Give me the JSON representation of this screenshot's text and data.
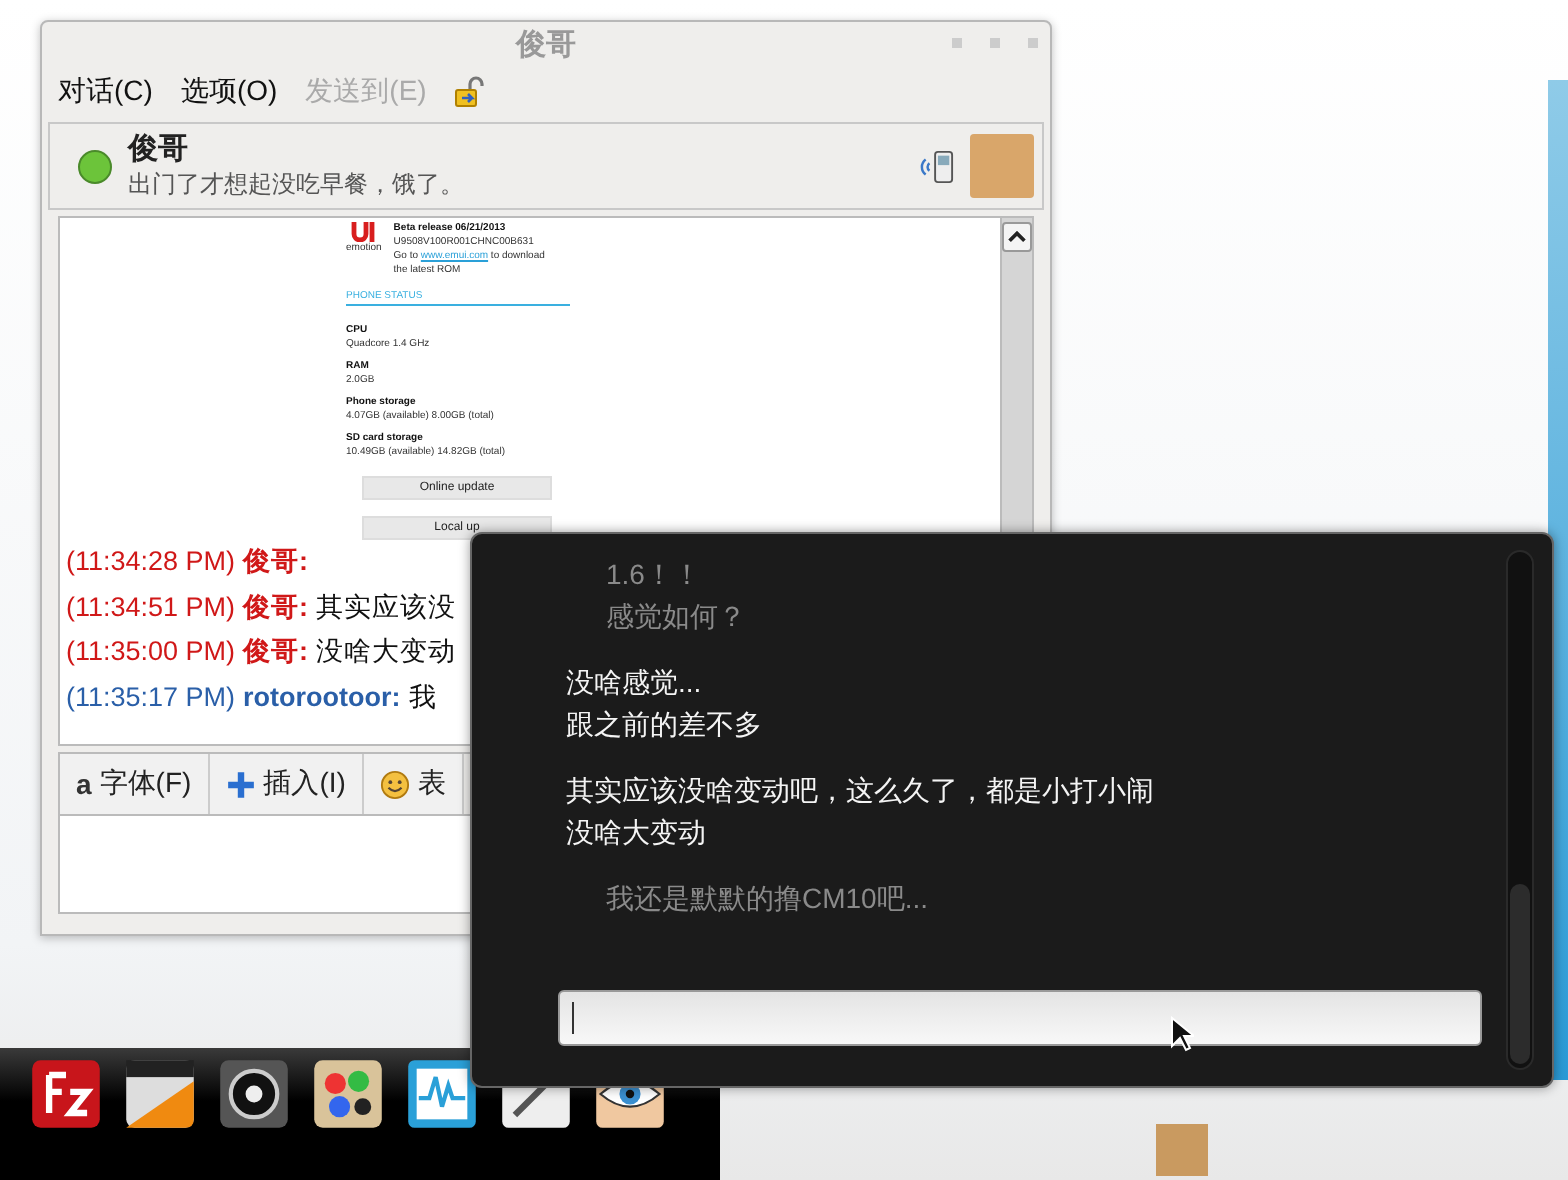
{
  "chat_window": {
    "title": "俊哥",
    "menu": [
      {
        "label": "对话(C)",
        "disabled": false
      },
      {
        "label": "选项(O)",
        "disabled": false
      },
      {
        "label": "发送到(E)",
        "disabled": true
      }
    ],
    "contact": {
      "name": "俊哥",
      "status_message": "出门了才想起没吃早餐，饿了。",
      "online": true
    },
    "shared_screenshot": {
      "logo_caption": "emotion",
      "release": "Beta release 06/21/2013",
      "build": "U9508V100R001CHNC00B631",
      "download_before": "Go to",
      "download_link": "www.emui.com",
      "download_after": "to download the latest ROM",
      "section_title": "PHONE STATUS",
      "specs": [
        {
          "label": "CPU",
          "value": "Quadcore 1.4 GHz"
        },
        {
          "label": "RAM",
          "value": "2.0GB"
        },
        {
          "label": "Phone storage",
          "value": "4.07GB (available)  8.00GB (total)"
        },
        {
          "label": "SD card storage",
          "value": "10.49GB (available)  14.82GB (total)"
        }
      ],
      "buttons": [
        "Online update",
        "Local up"
      ]
    },
    "messages": [
      {
        "time": "(11:34:28 PM)",
        "sender": "俊哥:",
        "kind": "contact"
      },
      {
        "time": "(11:34:51 PM)",
        "sender": "俊哥:",
        "text": "其实应该没",
        "kind": "contact"
      },
      {
        "time": "(11:35:00 PM)",
        "sender": "俊哥:",
        "text": "没啥大变动",
        "kind": "contact"
      },
      {
        "time": "(11:35:17 PM)",
        "sender": "rotorootoor:",
        "text": "我",
        "kind": "self"
      }
    ],
    "toolbar": [
      {
        "label": "字体(F)",
        "kind": "font",
        "glyph": "a"
      },
      {
        "label": "插入(I)",
        "kind": "insert"
      },
      {
        "label": "表",
        "kind": "smiley"
      }
    ]
  },
  "notification_popup": {
    "groups": [
      {
        "kind": "incoming",
        "lines": [
          "1.6！！",
          "感觉如何？"
        ]
      },
      {
        "kind": "outgoing",
        "lines": [
          "没啥感觉...",
          "跟之前的差不多"
        ]
      },
      {
        "kind": "outgoing",
        "lines": [
          "其实应该没啥变动吧，这么久了，都是小打小闹",
          "没啥大变动"
        ]
      },
      {
        "kind": "incoming",
        "lines": [
          "我还是默默的撸CM10吧..."
        ]
      }
    ]
  },
  "dock": {
    "items": [
      {
        "kind": "zigzag"
      },
      {
        "kind": "film"
      },
      {
        "kind": "circle"
      },
      {
        "kind": "palette"
      },
      {
        "kind": "waveform"
      },
      {
        "kind": "pencil"
      },
      {
        "kind": "eye"
      }
    ]
  }
}
